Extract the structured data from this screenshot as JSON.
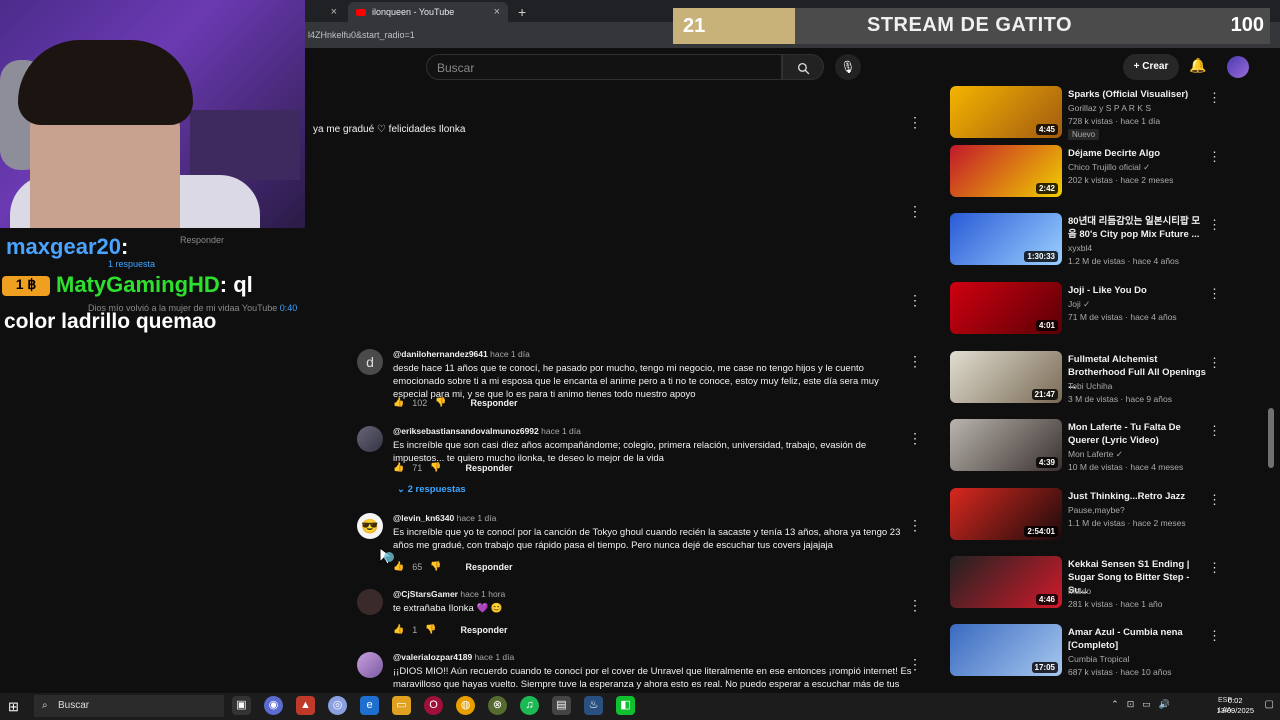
{
  "browser": {
    "tabs": [
      {
        "label": "",
        "active": false
      },
      {
        "label": "ilonqueen - YouTube",
        "active": true
      }
    ],
    "url": "l4ZHnkelfu0&start_radio=1"
  },
  "overlay": {
    "left_value": "21",
    "title": "STREAM DE GATITO",
    "right_value": "100"
  },
  "youtube": {
    "search_placeholder": "Buscar",
    "create_label": "Crear"
  },
  "chat": {
    "user1": "maxgear20",
    "user1_suffix": ":",
    "badge": "1 ฿",
    "user2": "MatyGamingHD",
    "user2_msg_inline": ": ql",
    "message": "color ladrillo quemao",
    "ghost_reply": "Responder",
    "ghost_replies": "1 respuesta",
    "ghost_comment": "Dios mío volvió a la mujer de mi vidaa YouTube",
    "ghost_time": "0:40"
  },
  "comments": {
    "partial_text": "ya me gradué ♡ felicidades Ilonka",
    "items": [
      {
        "author": "@danilohernandez9641",
        "time": "hace 1 día",
        "avatar_letter": "d",
        "text": "desde hace 11 años que te conocí, he pasado por mucho, tengo mi negocio, me case no tengo hijos y le cuento emocionado sobre ti a mi esposa que le encanta el anime pero a ti no te conoce, estoy muy feliz, este día sera muy especial para mi, y se que lo es para ti animo tienes todo nuestro apoyo",
        "likes": "102",
        "reply_label": "Responder"
      },
      {
        "author": "@eriksebastiansandovalmunoz6992",
        "time": "hace 1 día",
        "avatar_letter": "",
        "text": "Es increíble que son casi diez años acompañándome; colegio, primera relación, universidad, trabajo, evasión de impuestos... te quiero mucho ilonka, te deseo lo mejor de la vida",
        "likes": "71",
        "reply_label": "Responder",
        "replies_label": "2 respuestas"
      },
      {
        "author": "@levin_kn6340",
        "time": "hace 1 día",
        "avatar_letter": "",
        "text": "Es increíble que yo te conocí por la canción de Tokyo ghoul cuando recién la sacaste y tenía 13 años, ahora ya tengo 23 años me gradué, con trabajo que rápido pasa el tiempo. Pero nunca dejé de escuchar tus covers jajajaja",
        "likes": "65",
        "reply_label": "Responder"
      },
      {
        "author": "@CjStarsGamer",
        "time": "hace 1 hora",
        "avatar_letter": "",
        "text": "te extrañaba Ilonka 💜 😊",
        "likes": "1",
        "reply_label": "Responder"
      },
      {
        "author": "@valerialozpar4189",
        "time": "hace 1 día",
        "avatar_letter": "",
        "text": "¡¡DIOS MIO!! Aún recuerdo cuando te conocí por el cover de Unravel que literalmente en ese entonces ¡rompió internet! Es maravilloso que hayas vuelto. Siempre tuve la esperanza y ahora esto es real. No puedo esperar a escuchar más de tus covers con las nuevas canciones que han salido. Feliz regreso Ilonka. ✨ 💜 !!!",
        "likes": "",
        "reply_label": ""
      }
    ]
  },
  "recommendations": [
    {
      "title": "Sparks (Official Visualiser)",
      "channel": "Gorillaz y S P A R K S",
      "views": "728 k vistas · hace 1 día",
      "duration": "4:45",
      "badge": "Nuevo",
      "colors": [
        "#f5b400",
        "#a05a10"
      ]
    },
    {
      "title": "Déjame Decirte Algo",
      "channel": "Chico Trujillo oficial ✓",
      "views": "202 k vistas · hace 2 meses",
      "duration": "2:42",
      "badge": "",
      "colors": [
        "#c2182b",
        "#f0d000"
      ]
    },
    {
      "title": "80년대 리듬감있는 일본시티팝 모음 80's City pop Mix Future ...",
      "channel": "xyxbl4",
      "views": "1.2 M de vistas · hace 4 años",
      "duration": "1:30:33",
      "badge": "",
      "colors": [
        "#2a5ad6",
        "#9ad0ff"
      ]
    },
    {
      "title": "Joji - Like You Do",
      "channel": "Joji ✓",
      "views": "71 M de vistas · hace 4 años",
      "duration": "4:01",
      "badge": "",
      "colors": [
        "#d00010",
        "#5a0006"
      ]
    },
    {
      "title": "Fullmetal Alchemist Brotherhood Full All Openings ...",
      "channel": "Tobi Uchiha",
      "views": "3 M de vistas · hace 9 años",
      "duration": "21:47",
      "badge": "",
      "colors": [
        "#e0ddd0",
        "#7a6a55"
      ]
    },
    {
      "title": "Mon Laferte - Tu Falta De Querer (Lyric Video)",
      "channel": "Mon Laferte ✓",
      "views": "10 M de vistas · hace 4 meses",
      "duration": "4:39",
      "badge": "",
      "colors": [
        "#b9b4ad",
        "#3a3230"
      ]
    },
    {
      "title": "Just Thinking...Retro Jazz",
      "channel": "Pause,maybe?",
      "views": "1.1 M de vistas · hace 2 meses",
      "duration": "2:54:01",
      "badge": "",
      "colors": [
        "#d8281f",
        "#1a0b0b"
      ]
    },
    {
      "title": "Kekkai Sensen S1 Ending | Sugar Song to Bitter Step - Su...",
      "channel": "Maldo",
      "views": "281 k vistas · hace 1 año",
      "duration": "4:46",
      "badge": "",
      "colors": [
        "#222222",
        "#d01a2a"
      ]
    },
    {
      "title": "Amar Azul - Cumbia nena [Completo]",
      "channel": "Cumbia Tropical",
      "views": "687 k vistas · hace 10 años",
      "duration": "17:05",
      "badge": "",
      "colors": [
        "#3a6ac0",
        "#a8c8f0"
      ]
    }
  ],
  "taskbar": {
    "search_label": "Buscar",
    "lang_top": "ESP",
    "lang_bottom": "LAA",
    "time": "0:02",
    "date": "13/09/2025"
  }
}
